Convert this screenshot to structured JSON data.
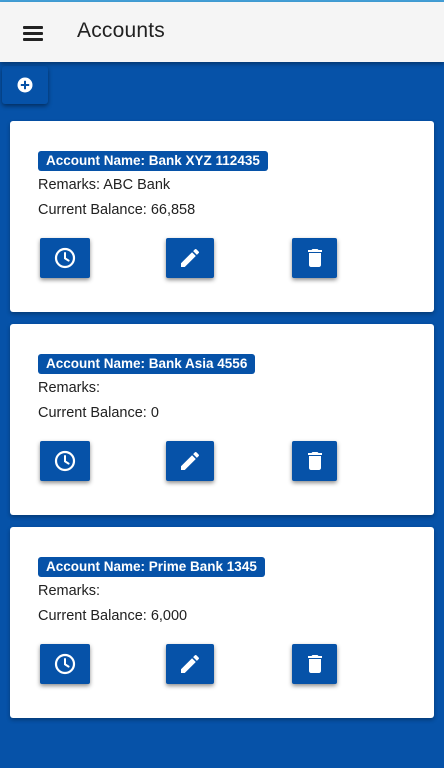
{
  "appbar": {
    "title": "Accounts"
  },
  "colors": {
    "primary": "#0652a8",
    "appbar_bg": "#f5f5f5",
    "card_bg": "#ffffff",
    "top_accent": "#43a0d9"
  },
  "icons": {
    "menu": "menu-icon",
    "add": "add-circle-icon",
    "history": "clock-icon",
    "edit": "pencil-icon",
    "delete": "trash-icon"
  },
  "accounts": [
    {
      "name_label": "Account Name: Bank XYZ 112435",
      "remarks": "Remarks: ABC Bank",
      "balance": "Current Balance: 66,858"
    },
    {
      "name_label": "Account Name: Bank Asia 4556",
      "remarks": "Remarks:",
      "balance": "Current Balance: 0"
    },
    {
      "name_label": "Account Name: Prime Bank 1345",
      "remarks": "Remarks:",
      "balance": "Current Balance: 6,000"
    }
  ]
}
